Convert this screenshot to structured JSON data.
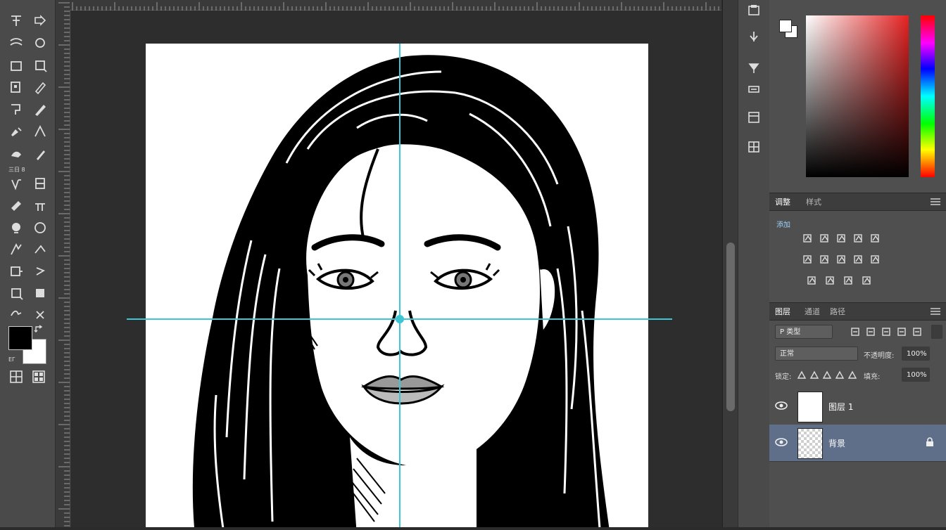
{
  "toolbar": {
    "tools": [
      "move-tool",
      "artboard-tool",
      "marquee-tool",
      "lasso-tool",
      "crop-tool",
      "frame-tool",
      "eyedropper-tool",
      "patch-tool",
      "frame-select-tool",
      "brush-tool",
      "healing-tool",
      "pencil-tool",
      "clone-stamp-tool",
      "smudge-tool",
      "history-brush-tool",
      "gradient-tool",
      "eraser-tool",
      "paint-bucket-tool",
      "blur-tool",
      "dodge-tool",
      "pen-tool",
      "direct-select-tool",
      "type-tool",
      "path-select-tool",
      "shape-tool",
      "rectangle-tool",
      "hand-tool",
      "zoom-tool"
    ],
    "small_label": "三日 8",
    "swatch_toggle_label": "ЕГ",
    "colors": {
      "foreground": "#000000",
      "background": "#ffffff"
    }
  },
  "canvas": {
    "guide_color": "#3ec6d4",
    "document_background": "#ffffff"
  },
  "color_panel": {
    "hue_base": "#e52222"
  },
  "adjustments_panel": {
    "tabs": [
      "调整",
      "样式"
    ],
    "add_label": "添加"
  },
  "layers_panel": {
    "tabs": [
      "图层",
      "通道",
      "路径"
    ],
    "filter_value": "P 类型",
    "blend_mode_value": "正常",
    "opacity_label": "不透明度:",
    "opacity_value": "100%",
    "lock_label": "锁定:",
    "fill_label": "填充:",
    "fill_value": "100%",
    "layers": [
      {
        "name": "图层 1",
        "visible": true,
        "selected": false,
        "thumb": "white",
        "locked": false
      },
      {
        "name": "背景",
        "visible": true,
        "selected": true,
        "thumb": "transparent",
        "locked": true
      }
    ]
  }
}
